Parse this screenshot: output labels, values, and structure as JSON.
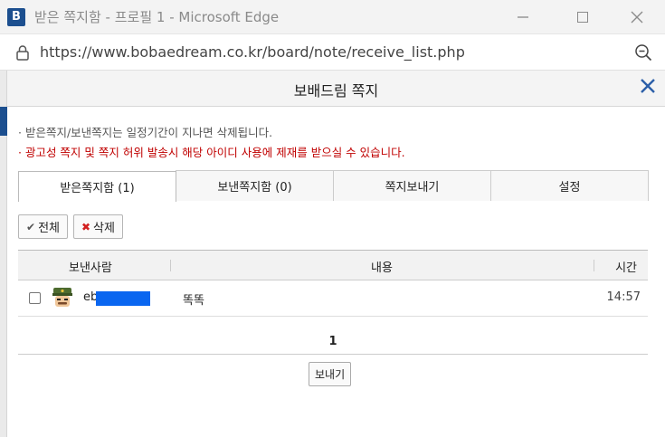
{
  "window": {
    "app_icon_letter": "B",
    "title": "받은 쪽지함 - 프로필 1 - Microsoft Edge",
    "url": "https://www.bobaedream.co.kr/board/note/receive_list.php"
  },
  "popup": {
    "title": "보배드림 쪽지",
    "notices": [
      "받은쪽지/보낸쪽지는 일정기간이 지나면 삭제됩니다.",
      "광고성 쪽지 및 쪽지 허위 발송시 해당 아이디 사용에 제재를 받으실 수 있습니다."
    ],
    "notice_colors": [
      "#555555",
      "#c00000"
    ]
  },
  "tabs": [
    {
      "label": "받은쪽지함 (1)",
      "active": true
    },
    {
      "label": "보낸쪽지함 (0)",
      "active": false
    },
    {
      "label": "쪽지보내기",
      "active": false
    },
    {
      "label": "설정",
      "active": false
    }
  ],
  "toolbar": {
    "select_all_label": "전체",
    "delete_label": "삭제"
  },
  "table": {
    "headers": {
      "sender": "보낸사람",
      "content": "내용",
      "time": "시간"
    },
    "rows": [
      {
        "sender": "eb",
        "content": "똑똑",
        "time": "14:57",
        "checked": false
      }
    ]
  },
  "pager": {
    "current": "1"
  },
  "send_button_label": "보내기",
  "icons": {
    "lock": "lock-icon",
    "zoom": "zoom-out-icon",
    "close": "close-icon",
    "check": "check-icon",
    "x": "x-icon"
  },
  "colors": {
    "accent": "#1c4f8f",
    "warning": "#c00000",
    "redaction": "#0a66f0"
  }
}
